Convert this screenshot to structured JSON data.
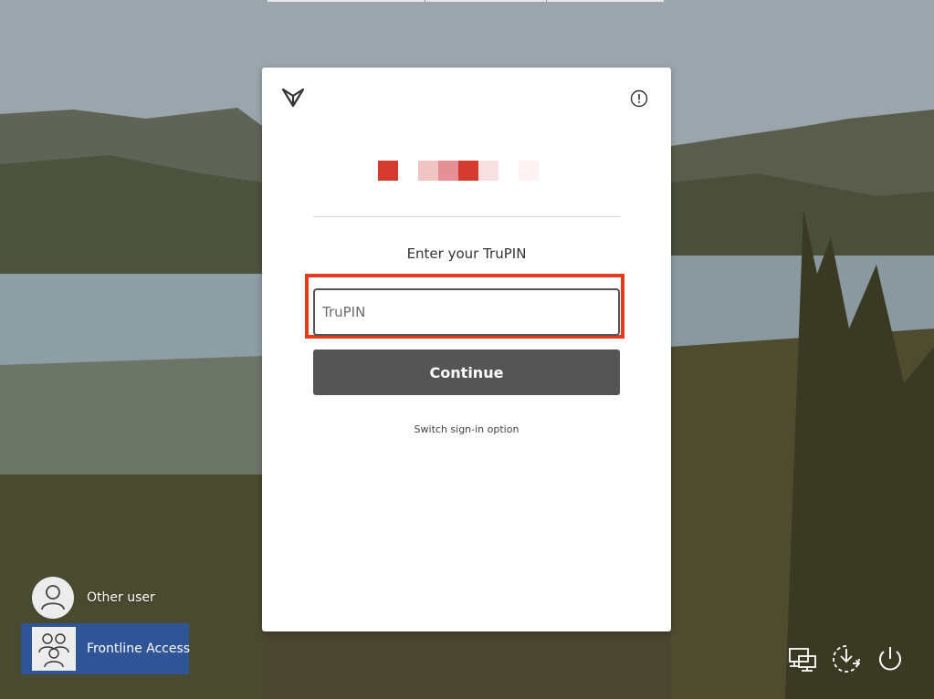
{
  "signin": {
    "prompt": "Enter your TruPIN",
    "pin_placeholder": "TruPIN",
    "pin_value": "",
    "continue_label": "Continue",
    "switch_label": "Switch sign-in option"
  },
  "icons": {
    "logo": "yubico-style-logo-icon",
    "info": "info-circle-icon",
    "network": "network-icon",
    "accessibility": "accessibility-icon",
    "power": "power-icon"
  },
  "colors": {
    "highlight": "#e8391a",
    "button": "#555555",
    "selected_user": "#2f5597",
    "pixel_colors": [
      "#d33b31",
      "#f0c3c5",
      "#e49096",
      "#d33b31",
      "#f8dfe2",
      "#fdf3f4"
    ]
  },
  "users": [
    {
      "name": "Other user",
      "icon": "user-silhouette-icon",
      "selected": false
    },
    {
      "name": "Frontline Access",
      "icon": "user-group-icon",
      "selected": true
    }
  ]
}
